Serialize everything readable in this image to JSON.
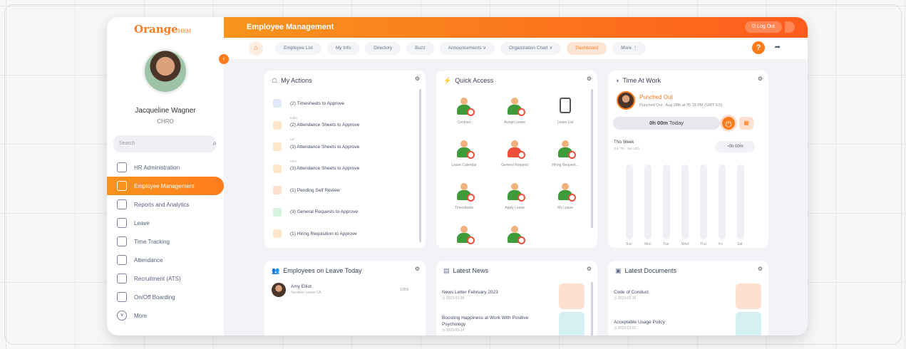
{
  "brand": {
    "logo_text": "Orange",
    "logo_suffix": "HRM"
  },
  "user": {
    "name": "Jacqueline Wagner",
    "role": "CHRO"
  },
  "search": {
    "placeholder": "Search"
  },
  "sidebar": {
    "items": [
      {
        "label": "HR Administration"
      },
      {
        "label": "Employee Management"
      },
      {
        "label": "Reports and Analytics"
      },
      {
        "label": "Leave"
      },
      {
        "label": "Time Tracking"
      },
      {
        "label": "Attendance"
      },
      {
        "label": "Recruitment (ATS)"
      },
      {
        "label": "On/Off Boarding"
      },
      {
        "label": "More"
      }
    ]
  },
  "header": {
    "title": "Employee Management",
    "logout": "Log Out"
  },
  "tabs": [
    "Employee List",
    "My Info",
    "Directory",
    "Buzz",
    "Announcements ∨",
    "Organization Chart ∨",
    "Dashboard",
    "More ⋮"
  ],
  "actions": {
    "title": "My Actions",
    "items": [
      {
        "label": "(2) Timesheets to Approve",
        "sub": "",
        "color": "#dfe7f8"
      },
      {
        "label": "(2) Attendance Sheets to Approve",
        "sub": "India",
        "color": "#fde7c8"
      },
      {
        "label": "(3) Attendance Sheets to Approve",
        "sub": "UK",
        "color": "#fde7c8"
      },
      {
        "label": "(3) Attendance Sheets to Approve",
        "sub": "USA",
        "color": "#fde7c8"
      },
      {
        "label": "(1) Pending Self Review",
        "sub": "",
        "color": "#fde0d0"
      },
      {
        "label": "(3) General Requests to Approve",
        "sub": "",
        "color": "#d6f2dc"
      },
      {
        "label": "(1) Hiring Requisition to Approve",
        "sub": "",
        "color": "#fde7c8"
      }
    ]
  },
  "quick": {
    "title": "Quick Access",
    "items": [
      "Contract",
      "Assign Leave",
      "Leave List",
      "Leave Calendar",
      "General Request",
      "Hiring Request...",
      "Timesheets",
      "Apply Leave",
      "My Leave",
      "",
      ""
    ]
  },
  "time": {
    "title": "Time At Work",
    "status": "Punched Out",
    "detail": "Punched Out : Aug 28th at 05:18 PM (GMT 5.5)",
    "today": "0h 00m",
    "today_suffix": "Today",
    "week_label": "This Week",
    "week_range": "Jun 7th - Jun 13th",
    "week_total": "0h 00m",
    "days": [
      "Sun",
      "Mon",
      "Tue",
      "Wed",
      "Thu",
      "Fri",
      "Sat"
    ]
  },
  "leave": {
    "title": "Employees on Leave Today",
    "name": "Amy Elliot",
    "sub": "Vacation Leave CA",
    "value": "1059"
  },
  "news": {
    "title": "Latest News",
    "items": [
      {
        "title": "News Letter February 2023",
        "date": "2023-03-20"
      },
      {
        "title": "Boosting Happiness at Work With Positive Psychology",
        "date": "2023-03-14"
      }
    ]
  },
  "docs": {
    "title": "Latest Documents",
    "items": [
      {
        "title": "Code of Conduct",
        "date": "2023-03-16"
      },
      {
        "title": "Acceptable Usage Policy",
        "date": "2023-03-01"
      }
    ]
  },
  "colors": {
    "accent": "#ff7b1d"
  }
}
